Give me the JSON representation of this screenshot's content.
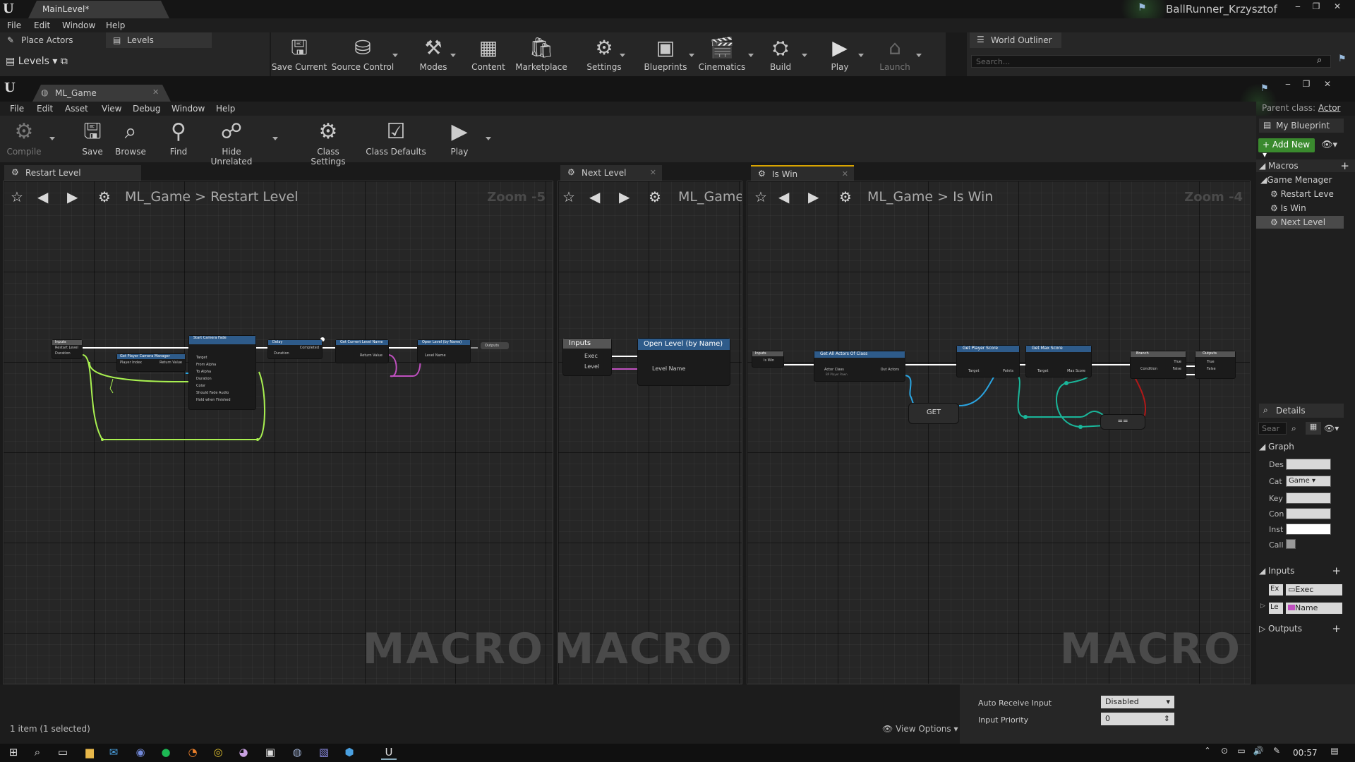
{
  "editor": {
    "doc_tab": "MainLevel*",
    "user": "BallRunner_Krzysztof",
    "menu": [
      "File",
      "Edit",
      "Window",
      "Help"
    ],
    "left_tabs": [
      "Place Actors",
      "Levels"
    ],
    "levels_label": "Levels",
    "toolbar": [
      "Save Current",
      "Source Control",
      "Modes",
      "Content",
      "Marketplace",
      "Settings",
      "Blueprints",
      "Cinematics",
      "Build",
      "Play",
      "Launch"
    ],
    "outliner_tab": "World Outliner",
    "outliner_search_placeholder": "Search..."
  },
  "blueprint": {
    "doc_tab": "ML_Game",
    "menu": [
      "File",
      "Edit",
      "Asset",
      "View",
      "Debug",
      "Window",
      "Help"
    ],
    "parent_class_label": "Parent class:",
    "parent_class_value": "Actor",
    "toolbar": [
      "Compile",
      "Save",
      "Browse",
      "Find",
      "Hide Unrelated",
      "Class Settings",
      "Class Defaults",
      "Play"
    ]
  },
  "panes": [
    {
      "tab": "Restart Level",
      "root": "ML_Game",
      "sep": ">",
      "leaf": "Restart Level",
      "zoom": "Zoom -5",
      "watermark": "MACRO"
    },
    {
      "tab": "Next Level",
      "root": "ML_Game",
      "sep": "",
      "leaf": "",
      "zoom": "",
      "watermark": "MACRO"
    },
    {
      "tab": "Is Win",
      "root": "ML_Game",
      "sep": ">",
      "leaf": "Is Win",
      "zoom": "Zoom -4",
      "watermark": "MACRO"
    }
  ],
  "graph_restart": {
    "nodes": [
      "Inputs",
      "Start Camera Fade",
      "Delay",
      "Get Current Level Name",
      "Open Level (by Name)",
      "Outputs",
      "Get Player Camera Manager"
    ],
    "pins": [
      "Restart Level",
      "Duration",
      "Player Index",
      "Return Value",
      "Target",
      "From Alpha",
      "To Alpha",
      "Duration",
      "Color",
      "Should Fade Audio",
      "Hold when Finished",
      "Completed",
      "Duration",
      "Return Value",
      "Level Name"
    ]
  },
  "graph_next": {
    "nodes": [
      "Inputs",
      "Open Level (by Name)"
    ],
    "pins": [
      "Exec",
      "Level",
      "Level Name"
    ]
  },
  "graph_iswin": {
    "nodes": [
      "Inputs",
      "Get All Actors Of Class",
      "GET",
      "Get Player Score",
      "Get Max Score",
      "Branch",
      "Outputs",
      "=="
    ],
    "pins": [
      "Is Win",
      "Actor Class",
      "BP Player Pawn",
      "Out Actors",
      "Target",
      "Points",
      "Target",
      "Max Score",
      "Condition",
      "True",
      "False",
      "True",
      "False"
    ]
  },
  "my_blueprint": {
    "tab": "My Blueprint",
    "add_new": "Add New",
    "macros_header": "Macros",
    "group": "Game Menager",
    "items": [
      "Restart Leve",
      "Is Win",
      "Next Level"
    ]
  },
  "details": {
    "tab": "Details",
    "search_placeholder": "Sear",
    "graph_header": "Graph",
    "props": [
      {
        "label": "Des",
        "value": ""
      },
      {
        "label": "Cat",
        "value": "Game"
      },
      {
        "label": "Key",
        "value": ""
      },
      {
        "label": "Con",
        "value": ""
      },
      {
        "label": "Inst",
        "value": ""
      },
      {
        "label": "Call",
        "value": ""
      }
    ],
    "inputs_header": "Inputs",
    "inputs": [
      {
        "short": "Ex",
        "type": "Exec"
      },
      {
        "short": "Le",
        "type": "Name"
      }
    ],
    "outputs_header": "Outputs"
  },
  "bottom": {
    "item_count": "1 item (1 selected)",
    "view_options": "View Options",
    "auto_receive_label": "Auto Receive Input",
    "auto_receive_value": "Disabled",
    "input_priority_label": "Input Priority",
    "input_priority_value": "0"
  },
  "taskbar": {
    "clock": "00:57"
  },
  "colors": {
    "exec_wire": "#ffffff",
    "float_wire": "#a8f050",
    "object_wire": "#2aa4e0",
    "name_wire": "#c050c0",
    "bool_wire": "#b01818",
    "node_header_func": "#2e5b8a",
    "add_new": "#3a8a2e"
  }
}
